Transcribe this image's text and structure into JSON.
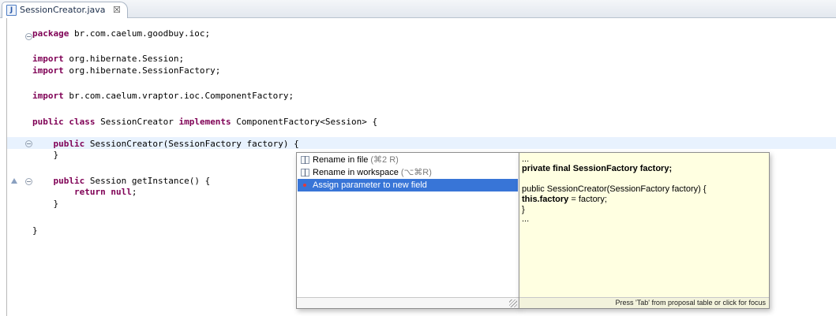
{
  "editor": {
    "tab": {
      "icon_letter": "J",
      "title": "SessionCreator.java",
      "close_glyph": "☒"
    }
  },
  "code": {
    "line1": {
      "kw": "package",
      "rest": " br.com.caelum.goodbuy.ioc;"
    },
    "line2": {
      "kw": "import",
      "rest": " org.hibernate.Session;"
    },
    "line3": {
      "kw": "import",
      "rest": " org.hibernate.SessionFactory;"
    },
    "line4": {
      "kw": "import",
      "rest": " br.com.caelum.vraptor.ioc.ComponentFactory;"
    },
    "line5": {
      "kw1": "public class",
      "mid": " SessionCreator ",
      "kw2": "implements",
      "rest": " ComponentFactory<Session> {"
    },
    "line6": {
      "indent": "    ",
      "kw": "public",
      "rest": " SessionCreator(SessionFactory factory) {"
    },
    "line7": {
      "text": "    }"
    },
    "line8": {
      "indent": "    ",
      "kw": "public",
      "rest": " Session getInstance() {"
    },
    "line9": {
      "indent": "        ",
      "kw": "return null",
      "rest": ";"
    },
    "line10": {
      "text": "    }"
    },
    "line11": {
      "text": "}"
    }
  },
  "quickfix": {
    "proposals": [
      {
        "label": "Rename in file",
        "key": "(⌘2 R)"
      },
      {
        "label": "Rename in workspace",
        "key": "(⌥⌘R)"
      },
      {
        "label": "Assign parameter to new field",
        "key": ""
      }
    ],
    "preview": {
      "l1": "...",
      "l2": "private final SessionFactory factory;",
      "l3": "public SessionCreator(SessionFactory factory) {",
      "l4_bold": "this.factory",
      "l4_rest": " = factory;",
      "l5": "}",
      "l6": "..."
    },
    "status_hint": "Press 'Tab' from proposal table or click for focus"
  }
}
